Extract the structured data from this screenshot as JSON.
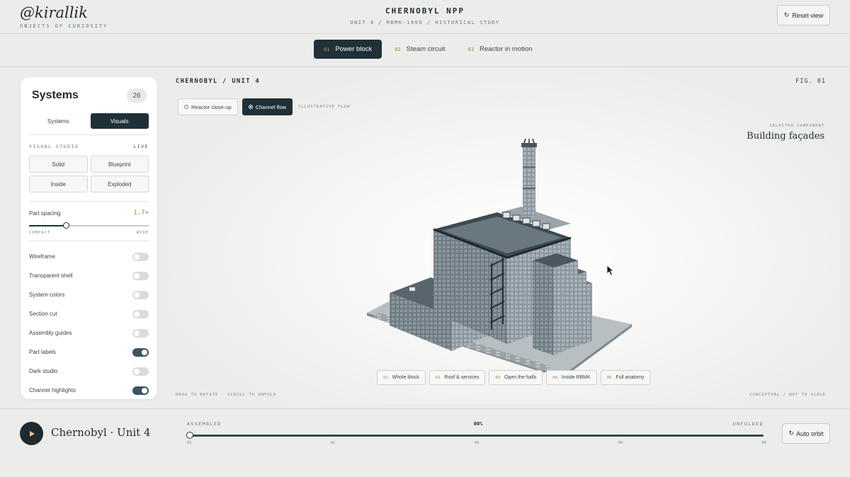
{
  "brand": {
    "name": "@kirallik",
    "subtitle": "OBJECTS OF CURIOSITY"
  },
  "header": {
    "title": "CHERNOBYL NPP",
    "subtitle": "UNIT 4 / RBMK-1000 / HISTORICAL STUDY",
    "reset_label": "Reset view",
    "reset_icon": "↻"
  },
  "tabs": [
    {
      "num": "01",
      "label": "Power block",
      "active": true
    },
    {
      "num": "02",
      "label": "Steam circuit",
      "active": false
    },
    {
      "num": "03",
      "label": "Reactor in motion",
      "active": false
    }
  ],
  "sidebar": {
    "title": "Systems",
    "count": "26",
    "segments": [
      {
        "label": "Systems",
        "active": false
      },
      {
        "label": "Visuals",
        "active": true
      }
    ],
    "visual_studio": {
      "label": "VISUAL STUDIO",
      "status": "LIVE"
    },
    "modes": [
      "Solid",
      "Blueprint",
      "Inside",
      "Exploded"
    ],
    "part_spacing": {
      "label": "Part spacing",
      "value": "1.7×",
      "fraction": 0.31,
      "min_label": "COMPACT",
      "max_label": "WIDE"
    },
    "toggles": [
      {
        "label": "Wireframe",
        "on": false
      },
      {
        "label": "Transparent shell",
        "on": false
      },
      {
        "label": "System colors",
        "on": false
      },
      {
        "label": "Section cut",
        "on": false
      },
      {
        "label": "Assembly guides",
        "on": false
      },
      {
        "label": "Part labels",
        "on": true
      },
      {
        "label": "Dark studio",
        "on": false
      },
      {
        "label": "Channel highlights",
        "on": true
      }
    ]
  },
  "viewport": {
    "title": "CHERNOBYL / UNIT 4",
    "fig": "FIG. 01",
    "view_buttons": [
      {
        "label": "Reactor close-up",
        "active": false
      },
      {
        "label": "Channel flow",
        "active": true
      }
    ],
    "illustrative": "ILLUSTRATIVE FLOW",
    "selected_label": "SELECTED COMPONENT",
    "selected_value": "Building façades",
    "presets": [
      {
        "num": "01",
        "label": "Whole block"
      },
      {
        "num": "02",
        "label": "Roof & services"
      },
      {
        "num": "03",
        "label": "Open the halls"
      },
      {
        "num": "04",
        "label": "Inside RBMK"
      },
      {
        "num": "05",
        "label": "Full anatomy"
      }
    ],
    "hint": "DRAG TO ROTATE · SCROLL TO UNFOLD",
    "scale_note": "CONCEPTUAL / NOT TO SCALE"
  },
  "bottom": {
    "title": "Chernobyl · Unit 4",
    "left_label": "ASSEMBLED",
    "progress_label": "00%",
    "progress": 0,
    "right_label": "UNFOLDED",
    "ticks": [
      "01",
      "02",
      "03",
      "04",
      "05"
    ],
    "orbit_label": "Auto orbit",
    "orbit_icon": "↻"
  },
  "colors": {
    "accent": "#1f3038",
    "number": "#b07a3c",
    "building": "#7d8a92"
  }
}
